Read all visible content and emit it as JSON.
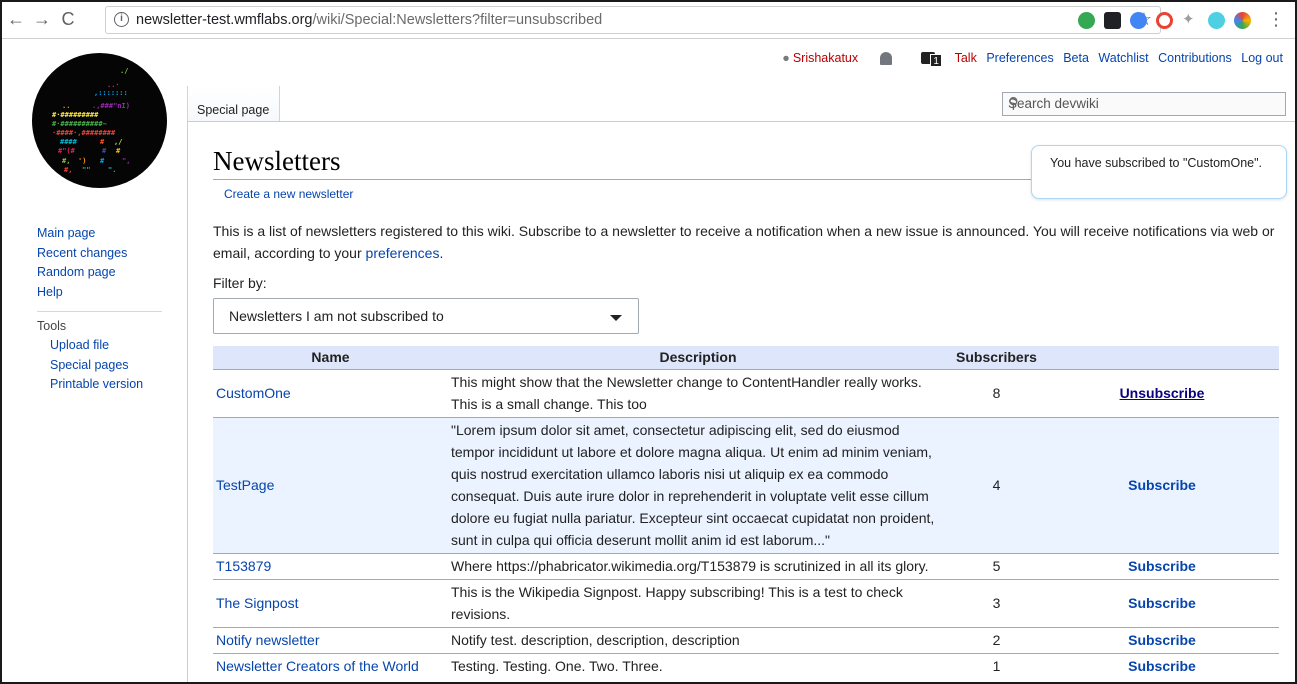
{
  "browser": {
    "url_prefix": "newsletter-test.wmflabs.org",
    "url_path": "/wiki/Special:Newsletters?filter=unsubscribed",
    "back": "←",
    "forward": "→",
    "reload": "C",
    "star": "☆",
    "menu": "⋮",
    "extension_colors": [
      "#34a853",
      "#202124",
      "#4285f4",
      "#ea4335",
      "#9e9e9e",
      "#4dd0e1",
      "#f4b400"
    ]
  },
  "personal": {
    "username": "Srishakatux",
    "tray_count": "1",
    "talk": "Talk",
    "preferences": "Preferences",
    "beta": "Beta",
    "watchlist": "Watchlist",
    "contributions": "Contributions",
    "logout": "Log out"
  },
  "tab": {
    "label": "Special page"
  },
  "search": {
    "placeholder": "Search devwiki"
  },
  "sidebar": {
    "navigation": [
      "Main page",
      "Recent changes",
      "Random page",
      "Help"
    ],
    "tools_heading": "Tools",
    "tools": [
      "Upload file",
      "Special pages",
      "Printable version"
    ]
  },
  "page": {
    "title": "Newsletters",
    "create_link": "Create a new newsletter",
    "notification": "You have subscribed to \"CustomOne\".",
    "intro_before": "This is a list of newsletters registered to this wiki. Subscribe to a newsletter to receive a notification when a new issue is announced. You will receive notifications via web or email, according to your ",
    "intro_link": "preferences",
    "intro_after": ".",
    "filter_label": "Filter by:",
    "filter_selected": "Newsletters I am not subscribed to"
  },
  "table": {
    "headers": {
      "name": "Name",
      "description": "Description",
      "subscribers": "Subscribers",
      "action": ""
    },
    "rows": [
      {
        "name": "CustomOne",
        "description": "This might show that the Newsletter change to ContentHandler really works. This is a small change. This too",
        "subscribers": "8",
        "action": "Unsubscribe"
      },
      {
        "name": "TestPage",
        "description": "\"Lorem ipsum dolor sit amet, consectetur adipiscing elit, sed do eiusmod tempor incididunt ut labore et dolore magna aliqua. Ut enim ad minim veniam, quis nostrud exercitation ullamco laboris nisi ut aliquip ex ea commodo consequat. Duis aute irure dolor in reprehenderit in voluptate velit esse cillum dolore eu fugiat nulla pariatur. Excepteur sint occaecat cupidatat non proident, sunt in culpa qui officia deserunt mollit anim id est laborum...\"",
        "subscribers": "4",
        "action": "Subscribe"
      },
      {
        "name": "T153879",
        "description": "Where https://phabricator.wikimedia.org/T153879 is scrutinized in all its glory.",
        "subscribers": "5",
        "action": "Subscribe"
      },
      {
        "name": "The Signpost",
        "description": "This is the Wikipedia Signpost. Happy subscribing! This is a test to check revisions.",
        "subscribers": "3",
        "action": "Subscribe"
      },
      {
        "name": "Notify newsletter",
        "description": "Notify test. description, description, description",
        "subscribers": "2",
        "action": "Subscribe"
      },
      {
        "name": "Newsletter Creators of the World",
        "description": "Testing. Testing. One. Two. Three.",
        "subscribers": "1",
        "action": "Subscribe"
      }
    ]
  }
}
